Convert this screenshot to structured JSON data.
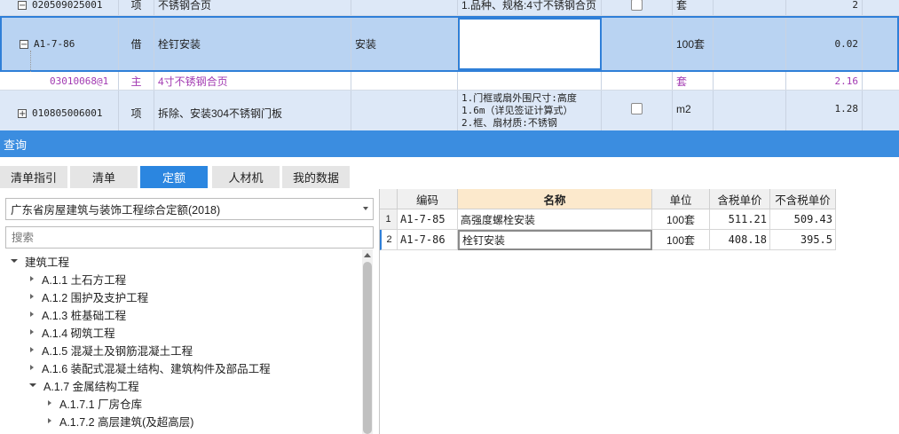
{
  "top_grid": {
    "rows": [
      {
        "code": "020509025001",
        "expand": "−",
        "type": "项",
        "name": "不锈钢合页",
        "desc": "1.品种、规格:4寸不锈钢合页",
        "unit": "套",
        "qty": "2",
        "checkbox": true
      },
      {
        "code": "A1-7-86",
        "expand": "−",
        "type": "借",
        "name": "栓钉安装",
        "category": "安装",
        "unit": "100套",
        "qty": "0.02"
      },
      {
        "code": "03010068@1",
        "type": "主",
        "name": "4寸不锈钢合页",
        "unit": "套",
        "qty": "2.16"
      },
      {
        "code": "010805006001",
        "expand": "+",
        "type": "项",
        "name": "拆除、安装304不锈钢门板",
        "desc_lines": [
          "1.门框或扇外围尺寸:高度",
          "1.6m（详见签证计算式）",
          "2.框、扇材质:不锈钢"
        ],
        "unit": "m2",
        "qty": "1.28",
        "checkbox": true
      }
    ]
  },
  "query_panel": {
    "title": "查询",
    "tabs": [
      "清单指引",
      "清单",
      "定额",
      "人材机",
      "我的数据"
    ],
    "active_tab": "定额",
    "quota_library": "广东省房屋建筑与装饰工程综合定额(2018)",
    "search_placeholder": "搜索",
    "tree": [
      {
        "label": "建筑工程",
        "level": 0,
        "state": "expanded"
      },
      {
        "label": "A.1.1 土石方工程",
        "level": 1,
        "state": "collapsed"
      },
      {
        "label": "A.1.2 围护及支护工程",
        "level": 1,
        "state": "collapsed"
      },
      {
        "label": "A.1.3 桩基础工程",
        "level": 1,
        "state": "collapsed"
      },
      {
        "label": "A.1.4 砌筑工程",
        "level": 1,
        "state": "collapsed"
      },
      {
        "label": "A.1.5 混凝土及钢筋混凝土工程",
        "level": 1,
        "state": "collapsed"
      },
      {
        "label": "A.1.6 装配式混凝土结构、建筑构件及部品工程",
        "level": 1,
        "state": "collapsed"
      },
      {
        "label": "A.1.7 金属结构工程",
        "level": 1,
        "state": "expanded"
      },
      {
        "label": "A.1.7.1 厂房仓库",
        "level": 2,
        "state": "collapsed"
      },
      {
        "label": "A.1.7.2 高层建筑(及超高层)",
        "level": 2,
        "state": "collapsed"
      }
    ],
    "result_grid": {
      "columns": [
        "编码",
        "名称",
        "单位",
        "含税单价",
        "不含税单价"
      ],
      "rows": [
        {
          "index": "1",
          "code": "A1-7-85",
          "name": "高强度螺栓安装",
          "unit": "100套",
          "price_tax": "511.21",
          "price_notax": "509.43"
        },
        {
          "index": "2",
          "code": "A1-7-86",
          "name": "栓钉安装",
          "unit": "100套",
          "price_tax": "408.18",
          "price_notax": "395.5"
        }
      ],
      "selected_row": 2
    }
  },
  "colors": {
    "header_blue": "#3b8de0",
    "tab_active": "#2b86e0",
    "selection_border": "#2f7fd8",
    "main_material_text": "#a23ab2"
  }
}
